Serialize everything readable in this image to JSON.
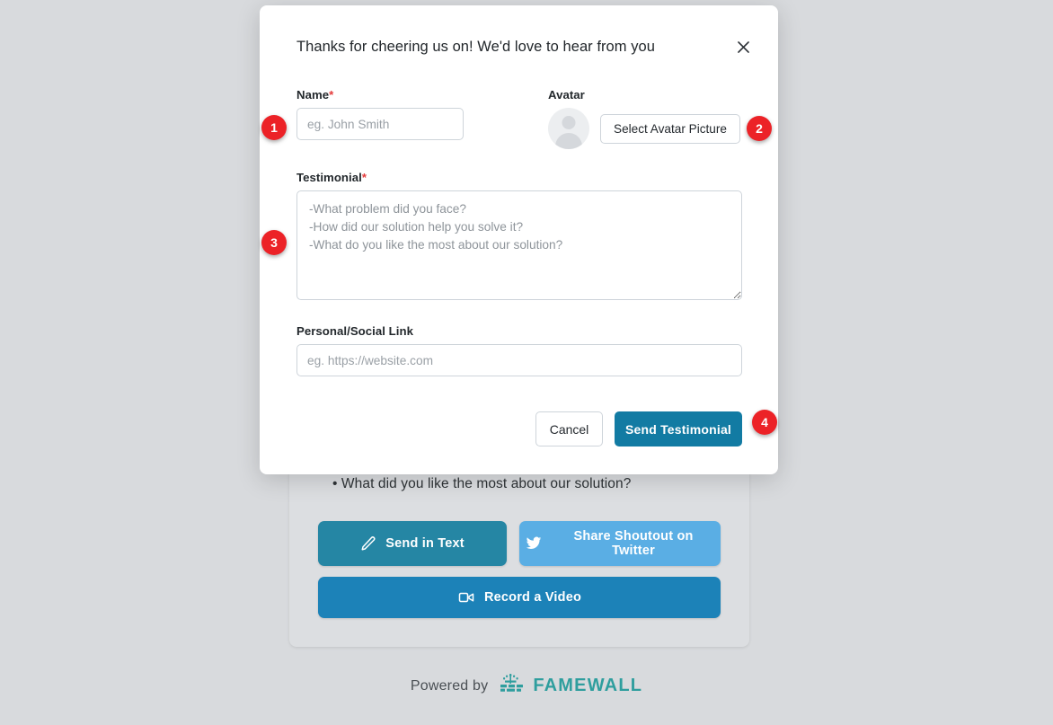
{
  "background_page": {
    "question": "• What did you like the most about our solution?",
    "buttons": [
      {
        "label": "Send in Text",
        "icon": "pencil-icon",
        "color": "#2586a4"
      },
      {
        "label": "Share Shoutout on Twitter",
        "icon": "twitter-icon",
        "color": "#5aaee4"
      },
      {
        "label": "Record a Video",
        "icon": "video-camera-icon",
        "color": "#1c82b8"
      }
    ],
    "footer": {
      "powered_by": "Powered by",
      "brand": "FAMEWALL",
      "brand_color": "#2f9e9e",
      "logo_icon": "famewall-logo-icon"
    }
  },
  "modal": {
    "title": "Thanks for cheering us on! We'd love to hear from you",
    "close_icon": "close-icon",
    "fields": {
      "name": {
        "label": "Name",
        "required": true,
        "required_mark": "*",
        "placeholder": "eg. John Smith",
        "value": ""
      },
      "avatar": {
        "label": "Avatar",
        "required": false,
        "button_label": "Select Avatar Picture",
        "avatar_icon": "user-avatar-placeholder-icon"
      },
      "testimonial": {
        "label": "Testimonial",
        "required": true,
        "required_mark": "*",
        "placeholder": "-What problem did you face?\n-How did our solution help you solve it?\n-What do you like the most about our solution?",
        "value": ""
      },
      "link": {
        "label": "Personal/Social Link",
        "required": false,
        "placeholder": "eg. https://website.com",
        "value": ""
      }
    },
    "actions": {
      "cancel_label": "Cancel",
      "send_label": "Send Testimonial",
      "send_color": "#127ba3"
    }
  },
  "step_badges": [
    {
      "number": "1",
      "target": "name-input"
    },
    {
      "number": "2",
      "target": "select-avatar-button"
    },
    {
      "number": "3",
      "target": "testimonial-textarea"
    },
    {
      "number": "4",
      "target": "send-testimonial-button"
    }
  ]
}
